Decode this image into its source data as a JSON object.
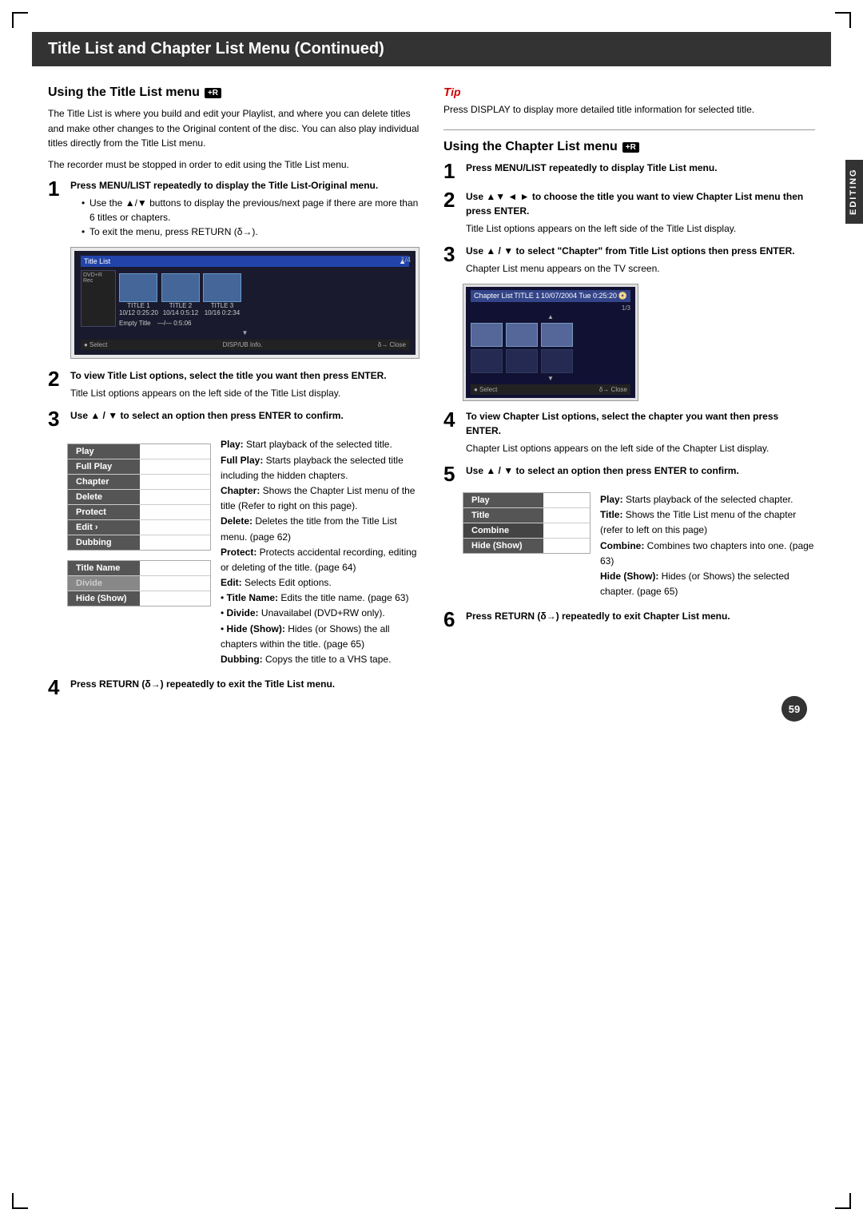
{
  "page": {
    "title": "Title List and Chapter List Menu (Continued)",
    "number": "59",
    "editing_label": "EDITING"
  },
  "left_column": {
    "section_title": "Using the Title List menu",
    "badge": "+R",
    "intro_paragraphs": [
      "The Title List is where you build and edit your Playlist, and where you can delete titles and make other changes to the Original content of the disc. You can also play individual titles directly from the Title List menu.",
      "The recorder must be stopped in order to edit using the Title List menu."
    ],
    "steps": [
      {
        "number": "1",
        "bold_text": "Press MENU/LIST repeatedly to display the Title List-Original menu.",
        "bullets": [
          "Use the ▲/▼ buttons to display the previous/next page if there are more than 6 titles or chapters.",
          "To exit the menu, press RETURN (δ→)."
        ]
      },
      {
        "number": "2",
        "bold_text": "To view Title List options, select the title you want then press ENTER.",
        "extra": "Title List options appears on the left side of the Title List display."
      },
      {
        "number": "3",
        "bold_text": "Use ▲ / ▼ to select an option then press ENTER to confirm."
      }
    ],
    "menu_items": [
      {
        "label": "Play",
        "active": true
      },
      {
        "label": "Full Play",
        "active": true
      },
      {
        "label": "Chapter",
        "active": true
      },
      {
        "label": "Delete",
        "active": true
      },
      {
        "label": "Protect",
        "active": true
      },
      {
        "label": "Edit",
        "active": true,
        "arrow": true
      },
      {
        "label": "Dubbing",
        "active": true
      }
    ],
    "menu_descriptions": [
      {
        "term": "Play:",
        "text": "Start playback of the selected title."
      },
      {
        "term": "Full Play:",
        "text": "Starts playback the selected title including the hidden chapters."
      },
      {
        "term": "Chapter:",
        "text": "Shows the Chapter List menu of the title (Refer to right on this page)."
      },
      {
        "term": "Delete:",
        "text": "Deletes the title from the Title List menu. (page 62)"
      },
      {
        "term": "Protect:",
        "text": "Protects accidental recording, editing or deleting of the title. (page 64)"
      },
      {
        "term": "Edit:",
        "text": "Selects Edit options."
      },
      {
        "term": "Title Name:",
        "text": "Edits the title name. (page 63)"
      },
      {
        "term": "Divide:",
        "text": "Unavailabel (DVD+RW only)."
      },
      {
        "term": "Hide (Show):",
        "text": "Hides (or Shows) the all chapters within the title. (page 65)"
      },
      {
        "term": "Dubbing:",
        "text": "Copys the title to a VHS tape."
      }
    ],
    "edit_submenu": [
      {
        "label": "Title Name",
        "active": true
      },
      {
        "label": "Divide",
        "active": false
      },
      {
        "label": "Hide (Show)",
        "active": true
      }
    ],
    "step4": {
      "number": "4",
      "bold_text": "Press RETURN (δ→) repeatedly to exit the Title List menu."
    }
  },
  "tip_section": {
    "icon": "T",
    "text": "Press DISPLAY to display more detailed title information for selected title."
  },
  "right_column": {
    "section_title": "Using the Chapter List menu",
    "badge": "+R",
    "steps": [
      {
        "number": "1",
        "bold_text": "Press MENU/LIST repeatedly to display Title List menu."
      },
      {
        "number": "2",
        "bold_text": "Use ▲▼ ◄ ► to choose the title you want to view Chapter List menu then press ENTER.",
        "extra": "Title List options appears on the left side of the Title List display."
      },
      {
        "number": "3",
        "bold_text": "Use ▲ / ▼ to select \"Chapter\" from Title List options then press ENTER.",
        "extra": "Chapter List menu appears on the TV screen."
      },
      {
        "number": "4",
        "bold_text": "To view Chapter List options, select the chapter you want then press ENTER.",
        "extra": "Chapter List options appears on the left side of the Chapter List display."
      },
      {
        "number": "5",
        "bold_text": "Use ▲ / ▼ to select an option then press ENTER to confirm."
      }
    ],
    "right_menu_items": [
      {
        "label": "Play",
        "active": true
      },
      {
        "label": "Title",
        "active": true
      },
      {
        "label": "Combine",
        "active": true
      },
      {
        "label": "Hide (Show)",
        "active": true
      }
    ],
    "right_descriptions": [
      {
        "term": "Play:",
        "text": "Starts playback of the selected chapter."
      },
      {
        "term": "Title:",
        "text": "Shows the Title List menu of the chapter (refer to left on this page)"
      },
      {
        "term": "Combine:",
        "text": "Combines two chapters into one. (page 63)"
      },
      {
        "term": "Hide (Show):",
        "text": "Hides (or Shows) the selected chapter. (page 65)"
      }
    ],
    "step6": {
      "number": "6",
      "bold_text": "Press RETURN (δ→) repeatedly to exit Chapter List menu."
    }
  },
  "screen1": {
    "title": "Title List",
    "pagination": "1/4",
    "titles": [
      "TITLE 1",
      "TITLE 2",
      "TITLE 3"
    ],
    "dates": [
      "10/12  0:25:20",
      "10/14  0:5:12",
      "10/16  0:2:34"
    ],
    "empty_title": "Empty Title",
    "empty_time": "—/—  0:5:06",
    "footer_select": "● Select",
    "footer_info": "DISP/UB Info.",
    "footer_close": "δ→ Close"
  },
  "screen2": {
    "title": "Chapter List",
    "title1": "TITLE 1",
    "date": "10/07/2004 Tue 0:25:20",
    "pagination": "1/3",
    "footer_select": "● Select",
    "footer_close": "δ→ Close"
  }
}
